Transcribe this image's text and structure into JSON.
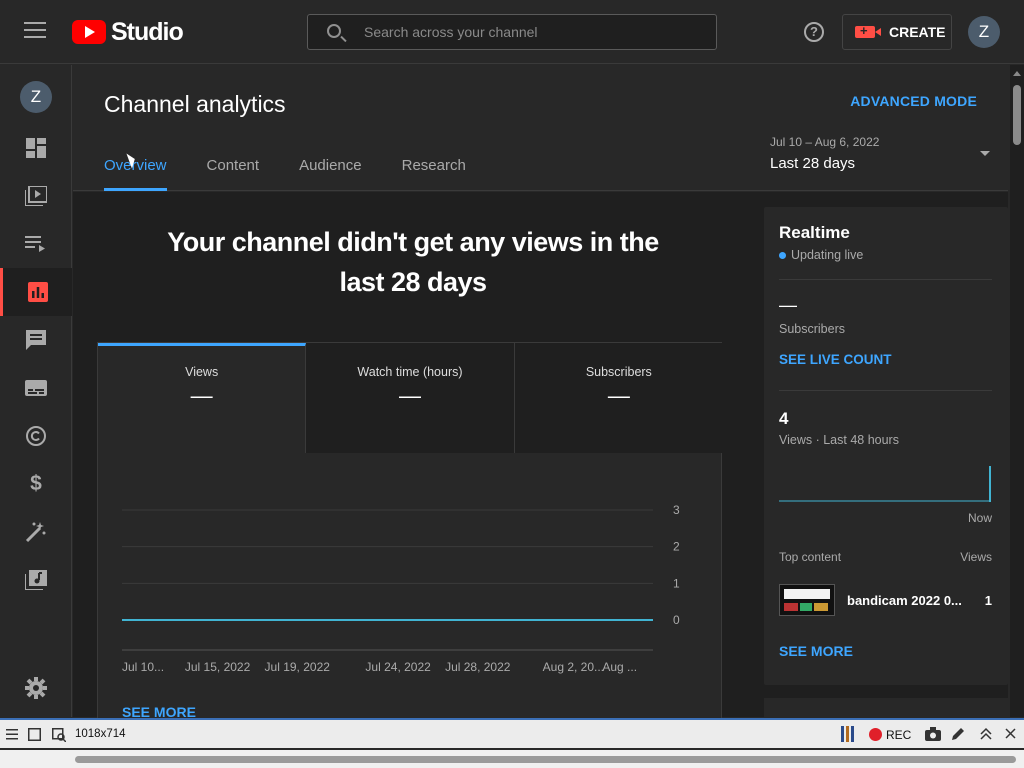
{
  "app": {
    "brand": "Studio",
    "search_placeholder": "Search across your channel",
    "create_label": "CREATE",
    "avatar_initial": "Z"
  },
  "sidebar": {
    "avatar_initial": "Z",
    "items": [
      {
        "icon": "dashboard-icon"
      },
      {
        "icon": "content-icon"
      },
      {
        "icon": "playlists-icon"
      },
      {
        "icon": "analytics-icon",
        "active": true
      },
      {
        "icon": "comments-icon"
      },
      {
        "icon": "subtitles-icon"
      },
      {
        "icon": "copyright-icon"
      },
      {
        "icon": "earn-icon"
      },
      {
        "icon": "customization-icon"
      },
      {
        "icon": "audio-library-icon"
      },
      {
        "icon": "settings-icon"
      }
    ]
  },
  "header": {
    "title": "Channel analytics",
    "advanced_mode": "ADVANCED MODE",
    "tabs": [
      {
        "label": "Overview",
        "active": true
      },
      {
        "label": "Content"
      },
      {
        "label": "Audience"
      },
      {
        "label": "Research"
      }
    ],
    "date_range": "Jul 10 – Aug 6, 2022",
    "date_period": "Last 28 days"
  },
  "overview": {
    "headline_line1": "Your channel didn't get any views in the",
    "headline_line2": "last 28 days",
    "metrics": [
      {
        "label": "Views",
        "value": "—",
        "active": true
      },
      {
        "label": "Watch time (hours)",
        "value": "—"
      },
      {
        "label": "Subscribers",
        "value": "—"
      }
    ],
    "see_more": "SEE MORE"
  },
  "chart_data": {
    "type": "line",
    "x": [
      "Jul 10...",
      "Jul 15, 2022",
      "Jul 19, 2022",
      "Jul 24, 2022",
      "Jul 28, 2022",
      "Aug 2, 20...",
      "Aug ..."
    ],
    "series": [
      {
        "values": [
          0,
          0,
          0,
          0,
          0,
          0,
          0
        ]
      }
    ],
    "y_ticks": [
      "3",
      "2",
      "1",
      "0"
    ],
    "ylim": [
      0,
      3
    ],
    "grid": true,
    "color": "#41b4d2"
  },
  "realtime": {
    "title": "Realtime",
    "status": "Updating live",
    "subscribers_value": "—",
    "subscribers_label": "Subscribers",
    "see_live_count": "SEE LIVE COUNT",
    "views_value": "4",
    "views_label": "Views · Last 48 hours",
    "mini_chart_values": [
      0,
      0,
      0,
      0,
      0,
      0,
      0,
      0,
      0,
      0,
      0,
      0,
      0,
      0,
      0,
      0,
      0,
      0,
      0,
      0,
      0,
      0,
      0,
      0,
      0,
      0,
      0,
      0,
      0,
      0,
      0,
      0,
      0,
      0,
      0,
      0,
      0,
      0,
      0,
      0,
      0,
      0,
      0,
      0,
      0,
      0,
      0,
      4
    ],
    "now_label": "Now",
    "top_content_label": "Top content",
    "views_header": "Views",
    "top_video_title": "bandicam 2022 0...",
    "top_video_views": "1",
    "see_more": "SEE MORE"
  },
  "recorder": {
    "size": "1018x714",
    "rec_label": "REC"
  },
  "colors": {
    "accent": "#3ea6ff",
    "brand_red": "#ff0000",
    "active_nav": "#ff4e45",
    "background": "#282828"
  }
}
